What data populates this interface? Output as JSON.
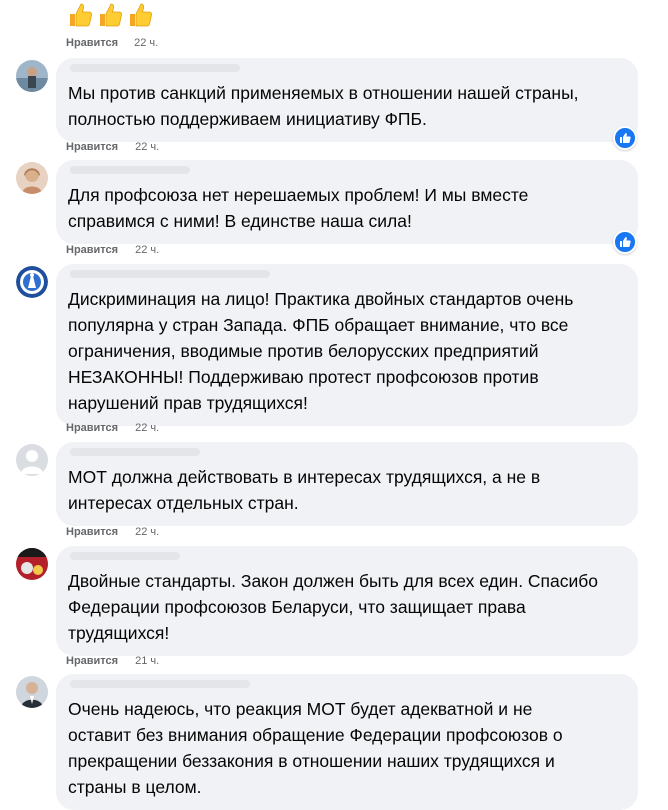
{
  "top": {
    "emoji": [
      "thumbs-up-icon",
      "thumbs-up-icon",
      "thumbs-up-icon"
    ],
    "like_label": "Нравится",
    "time": "22 ч."
  },
  "comments": [
    {
      "text": "Мы против санкций применяемых в отношении нашей страны,\nполностью поддерживаем инициативу ФПБ.",
      "like_label": "Нравится",
      "time": "22 ч.",
      "reaction": "like-reaction-icon"
    },
    {
      "text": "Для профсоюза нет нерешаемых проблем! И мы вместе\nсправимся с ними! В единстве наша сила!",
      "like_label": "Нравится",
      "time": "22 ч.",
      "reaction": "like-reaction-icon"
    },
    {
      "text": "Дискриминация на лицо! Практика двойных стандартов очень\nпопулярна у стран Запада. ФПБ обращает внимание, что все\nограничения, вводимые против белорусских предприятий\nНЕЗАКОННЫ! Поддерживаю протест профсоюзов против\nнарушений прав трудящихся!",
      "like_label": "Нравится",
      "time": "22 ч."
    },
    {
      "text": "МОТ должна действовать в интересах трудящихся, а не в\nинтересах отдельных стран.",
      "like_label": "Нравится",
      "time": "22 ч."
    },
    {
      "text": "Двойные стандарты. Закон должен быть для всех един. Спасибо\nФедерации профсоюзов Беларуси, что защищает права\nтрудящихся!",
      "like_label": "Нравится",
      "time": "21 ч."
    },
    {
      "text": "Очень надеюсь, что реакция МОТ будет адекватной и не\nоставит без внимания обращение Федерации профсоюзов о\nпрекращении беззакония в отношении наших трудящихся и\nстраны в целом."
    }
  ],
  "colors": {
    "bubble": "#f0f2f5",
    "meta": "#65676b",
    "reaction": "#1877f2"
  }
}
